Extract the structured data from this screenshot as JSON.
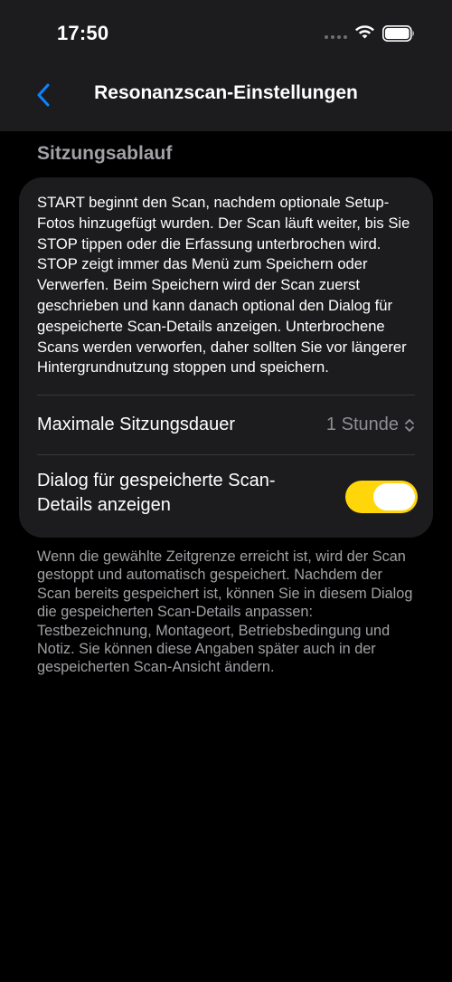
{
  "status_bar": {
    "time": "17:50",
    "icons": [
      "signal-icon",
      "wifi-icon",
      "battery-icon"
    ]
  },
  "nav": {
    "back_icon": "chevron-left-icon",
    "title": "Resonanzscan-Einstellungen"
  },
  "section": {
    "header": "Sitzungsablauf",
    "description": "START beginnt den Scan, nachdem optionale Setup-Fotos hinzugefügt wurden. Der Scan läuft weiter, bis Sie STOP tippen oder die Erfassung unterbrochen wird. STOP zeigt immer das Menü zum Speichern oder Verwerfen. Beim Speichern wird der Scan zuerst geschrieben und kann danach optional den Dialog für gespeicherte Scan-Details anzeigen. Unterbrochene Scans werden verworfen, daher sollten Sie vor längerer Hintergrundnutzung stoppen und speichern.",
    "max_duration": {
      "label": "Maximale Sitzungsdauer",
      "value": "1 Stunde"
    },
    "saved_dialog": {
      "label": "Dialog für gespeicherte Scan-Details anzeigen",
      "enabled": true
    },
    "footer": "Wenn die gewählte Zeitgrenze erreicht ist, wird der Scan gestoppt und automatisch gespeichert. Nachdem der Scan bereits gespeichert ist, können Sie in diesem Dialog die gespeicherten Scan-Details anpassen: Testbezeichnung, Montageort, Betriebs­bedingung und Notiz. Sie können diese Angaben später auch in der gespeicherten Scan-Ansicht ändern."
  },
  "colors": {
    "background": "#000000",
    "card": "#1c1c1e",
    "accent_blue": "#0a84ff",
    "toggle_on": "#ffd60a",
    "secondary_text": "#a1a1a6"
  }
}
